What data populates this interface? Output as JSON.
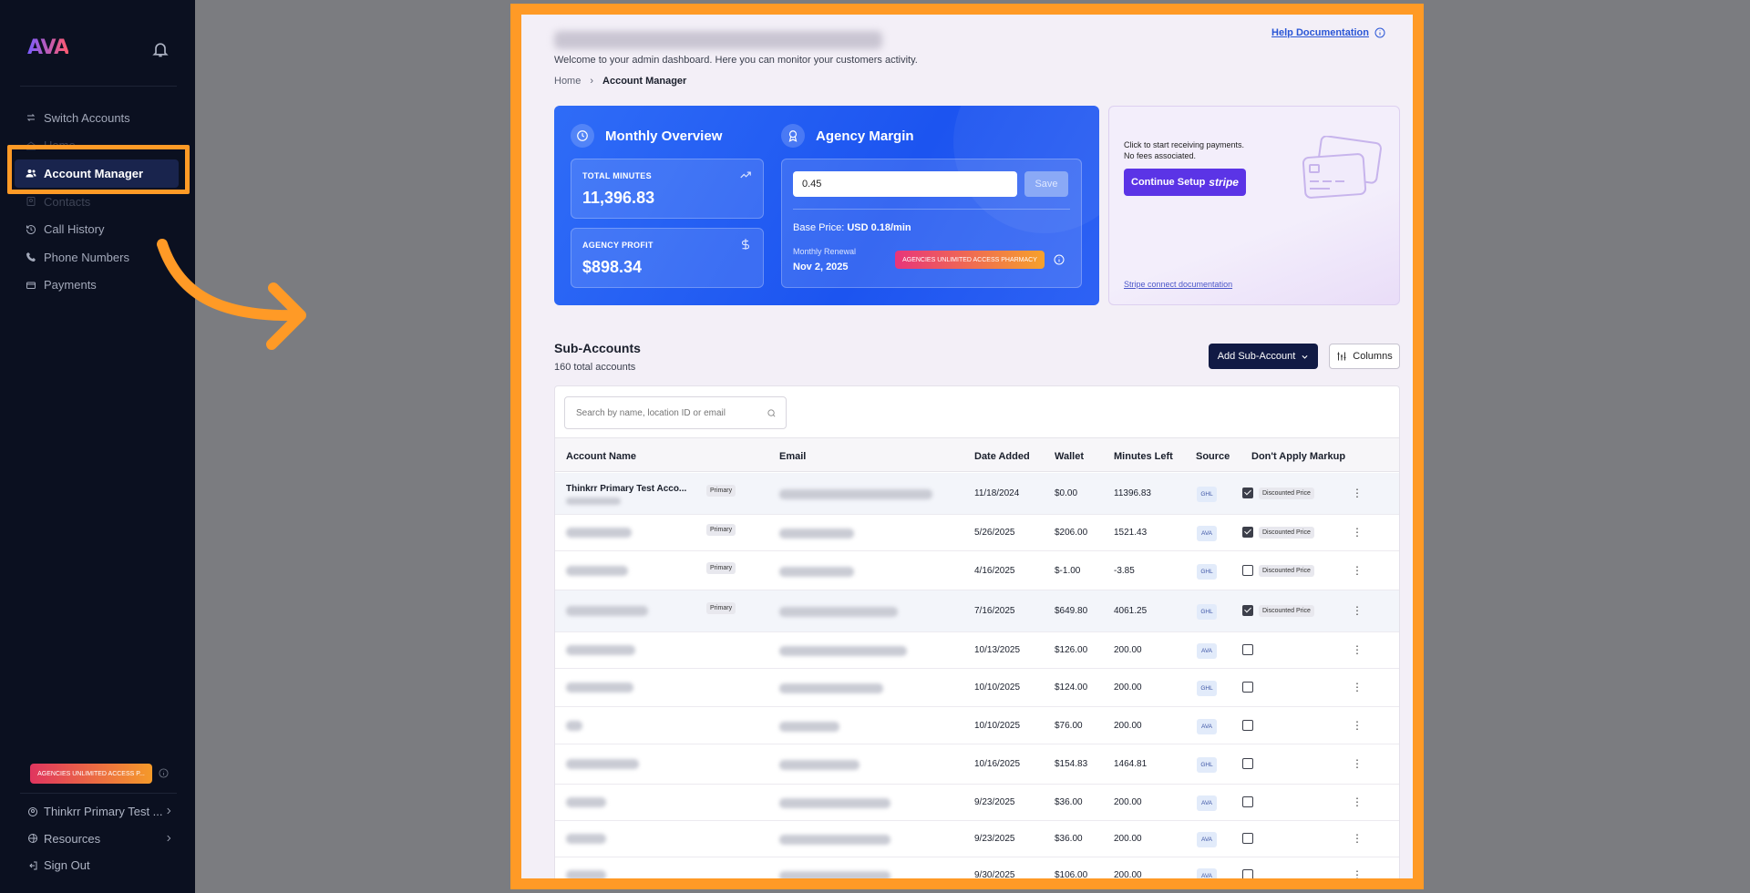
{
  "sidebar": {
    "logo": "AVA",
    "nav": [
      {
        "label": "Switch Accounts",
        "icon": "switch-icon"
      },
      {
        "label": "Home",
        "icon": "home-icon"
      },
      {
        "label": "Account Manager",
        "icon": "users-icon"
      },
      {
        "label": "Contacts",
        "icon": "contacts-icon"
      },
      {
        "label": "Call History",
        "icon": "history-icon"
      },
      {
        "label": "Phone Numbers",
        "icon": "phone-icon"
      },
      {
        "label": "Payments",
        "icon": "wallet-icon"
      }
    ],
    "plan_badge": "AGENCIES UNLIMITED ACCESS P...",
    "bottom": [
      {
        "label": "Thinkrr Primary Test ...",
        "icon": "account-icon"
      },
      {
        "label": "Resources",
        "icon": "resources-icon"
      },
      {
        "label": "Sign Out",
        "icon": "sign-out-icon"
      }
    ]
  },
  "header": {
    "help_label": "Help Documentation",
    "subtitle": "Welcome to your admin dashboard. Here you can monitor your customers activity.",
    "breadcrumb": {
      "home": "Home",
      "current": "Account Manager"
    }
  },
  "overview": {
    "title": "Monthly Overview",
    "total_minutes_label": "TOTAL MINUTES",
    "total_minutes_value": "11,396.83",
    "agency_profit_label": "AGENCY PROFIT",
    "agency_profit_value": "$898.34"
  },
  "margin": {
    "title": "Agency Margin",
    "input_value": "0.45",
    "save_label": "Save",
    "base_price_label": "Base Price:",
    "base_price_value": "USD 0.18/min",
    "renewal_label": "Monthly Renewal",
    "renewal_date": "Nov 2, 2025",
    "plan": "AGENCIES UNLIMITED ACCESS PHARMACY"
  },
  "stripe": {
    "line1": "Click to start receiving payments.",
    "line2": "No fees associated.",
    "button_label": "Continue Setup",
    "button_brand": "stripe",
    "doc_link": "Stripe connect documentation"
  },
  "subaccounts": {
    "title": "Sub-Accounts",
    "count": "160 total accounts",
    "add_label": "Add Sub-Account",
    "columns_label": "Columns",
    "search_placeholder": "Search by name, location ID or email",
    "headers": [
      "Account Name",
      "Email",
      "Date Added",
      "Wallet",
      "Minutes Left",
      "Source",
      "Don't Apply Markup"
    ],
    "primary_tag": "Primary",
    "discount_tag": "Discounted Price",
    "rows": [
      {
        "name": "Thinkrr Primary Test Acco...",
        "primary": true,
        "date": "11/18/2024",
        "wallet": "$0.00",
        "minutes": "11396.83",
        "source": "GHL",
        "markup": true
      },
      {
        "name": "",
        "primary": true,
        "date": "5/26/2025",
        "wallet": "$206.00",
        "minutes": "1521.43",
        "source": "AVA",
        "markup": true
      },
      {
        "name": "",
        "primary": true,
        "date": "4/16/2025",
        "wallet": "$-1.00",
        "minutes": "-3.85",
        "source": "GHL",
        "markup": false,
        "discount": true
      },
      {
        "name": "",
        "primary": true,
        "date": "7/16/2025",
        "wallet": "$649.80",
        "minutes": "4061.25",
        "source": "GHL",
        "markup": true
      },
      {
        "name": "",
        "primary": false,
        "date": "10/13/2025",
        "wallet": "$126.00",
        "minutes": "200.00",
        "source": "AVA",
        "markup": false
      },
      {
        "name": "",
        "primary": false,
        "date": "10/10/2025",
        "wallet": "$124.00",
        "minutes": "200.00",
        "source": "GHL",
        "markup": false
      },
      {
        "name": "",
        "primary": false,
        "date": "10/10/2025",
        "wallet": "$76.00",
        "minutes": "200.00",
        "source": "AVA",
        "markup": false
      },
      {
        "name": "",
        "primary": false,
        "date": "10/16/2025",
        "wallet": "$154.83",
        "minutes": "1464.81",
        "source": "GHL",
        "markup": false
      },
      {
        "name": "",
        "primary": false,
        "date": "9/23/2025",
        "wallet": "$36.00",
        "minutes": "200.00",
        "source": "AVA",
        "markup": false
      },
      {
        "name": "",
        "primary": false,
        "date": "9/23/2025",
        "wallet": "$36.00",
        "minutes": "200.00",
        "source": "AVA",
        "markup": false
      },
      {
        "name": "",
        "primary": false,
        "date": "9/30/2025",
        "wallet": "$106.00",
        "minutes": "200.00",
        "source": "AVA",
        "markup": false
      }
    ]
  },
  "colors": {
    "accent": "#ff9a26",
    "primary_blue": "#1f57f1",
    "sidebar_bg": "#0b1020",
    "stripe_purple": "#5b34e6"
  }
}
